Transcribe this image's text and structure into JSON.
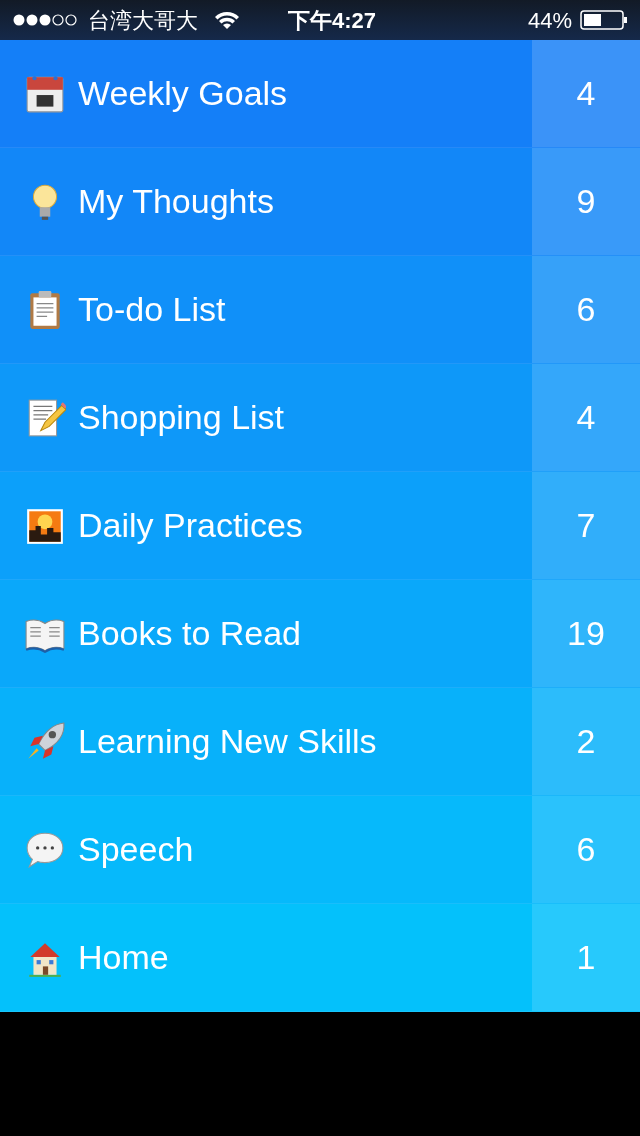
{
  "status_bar": {
    "carrier": "台湾大哥大",
    "time": "下午4:27",
    "battery": "44%"
  },
  "lists": [
    {
      "kind": "calendar",
      "title": "Weekly Goals",
      "count": "4"
    },
    {
      "kind": "bulb",
      "title": "My Thoughts",
      "count": "9"
    },
    {
      "kind": "clipboard",
      "title": "To-do List",
      "count": "6"
    },
    {
      "kind": "memo",
      "title": "Shopping List",
      "count": "4"
    },
    {
      "kind": "sunset",
      "title": "Daily Practices",
      "count": "7"
    },
    {
      "kind": "book",
      "title": "Books to Read",
      "count": "19"
    },
    {
      "kind": "rocket",
      "title": "Learning New Skills",
      "count": "2"
    },
    {
      "kind": "speech",
      "title": "Speech",
      "count": "6"
    },
    {
      "kind": "house",
      "title": "Home",
      "count": "1"
    }
  ]
}
